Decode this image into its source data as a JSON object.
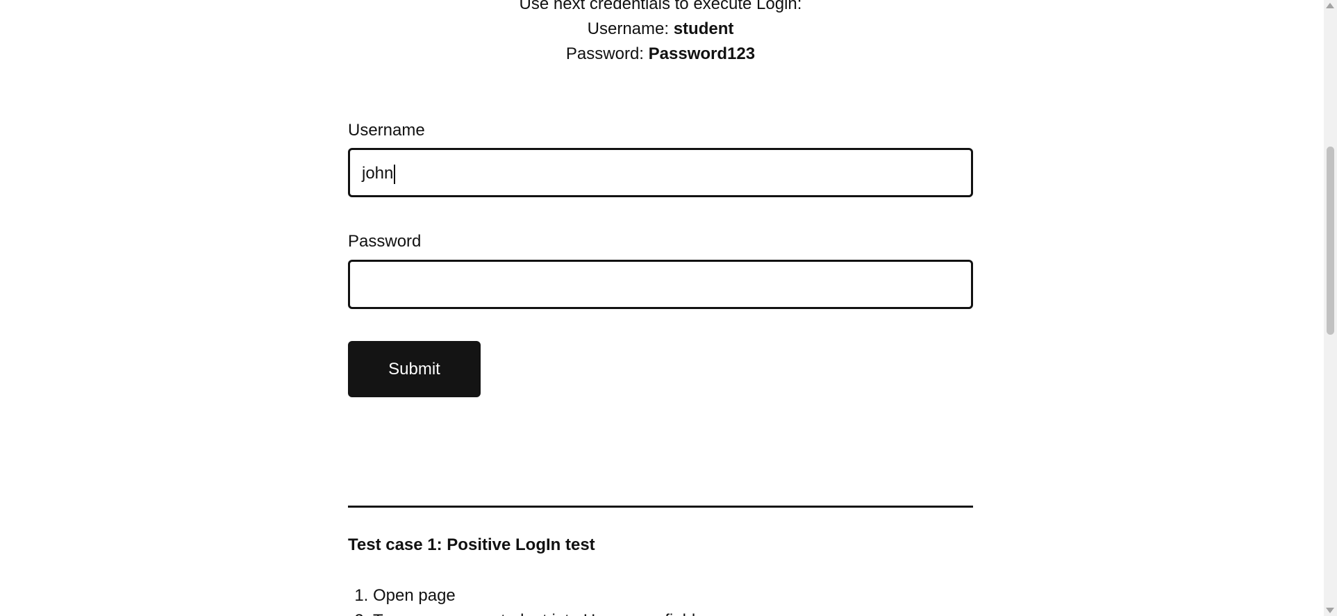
{
  "intro": {
    "line1": "Use next credentials to execute Login:",
    "username_label": "Username:",
    "username_value": "student",
    "password_label": "Password:",
    "password_value": "Password123"
  },
  "form": {
    "username_label": "Username",
    "username_value": "john",
    "password_label": "Password",
    "password_value": "",
    "submit_label": "Submit"
  },
  "test_case": {
    "title": "Test case 1: Positive LogIn test",
    "steps": [
      "Open page",
      "Type username student into Username field"
    ]
  }
}
